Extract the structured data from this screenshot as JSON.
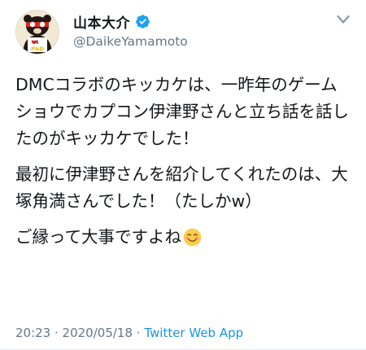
{
  "author": {
    "display_name": "山本大介",
    "handle": "@DaikeYamamoto",
    "avatar_text": "I ♥ P&D"
  },
  "tweet": {
    "paragraphs": [
      "DMCコラボのキッカケは、一昨年のゲームショウでカプコン伊津野さんと立ち話を話したのがキッカケでした！",
      "最初に伊津野さんを紹介してくれたのは、大塚角満さんでした！（たしかw）"
    ],
    "last_paragraph": "ご縁って大事ですよね",
    "emoji": "smiling-face-emoji"
  },
  "meta": {
    "time": "20:23",
    "separator": " · ",
    "date": "2020/05/18",
    "source": "Twitter Web App"
  },
  "colors": {
    "verified": "#1da1f2",
    "secondary_text": "#657786",
    "link": "#1b95e0"
  }
}
